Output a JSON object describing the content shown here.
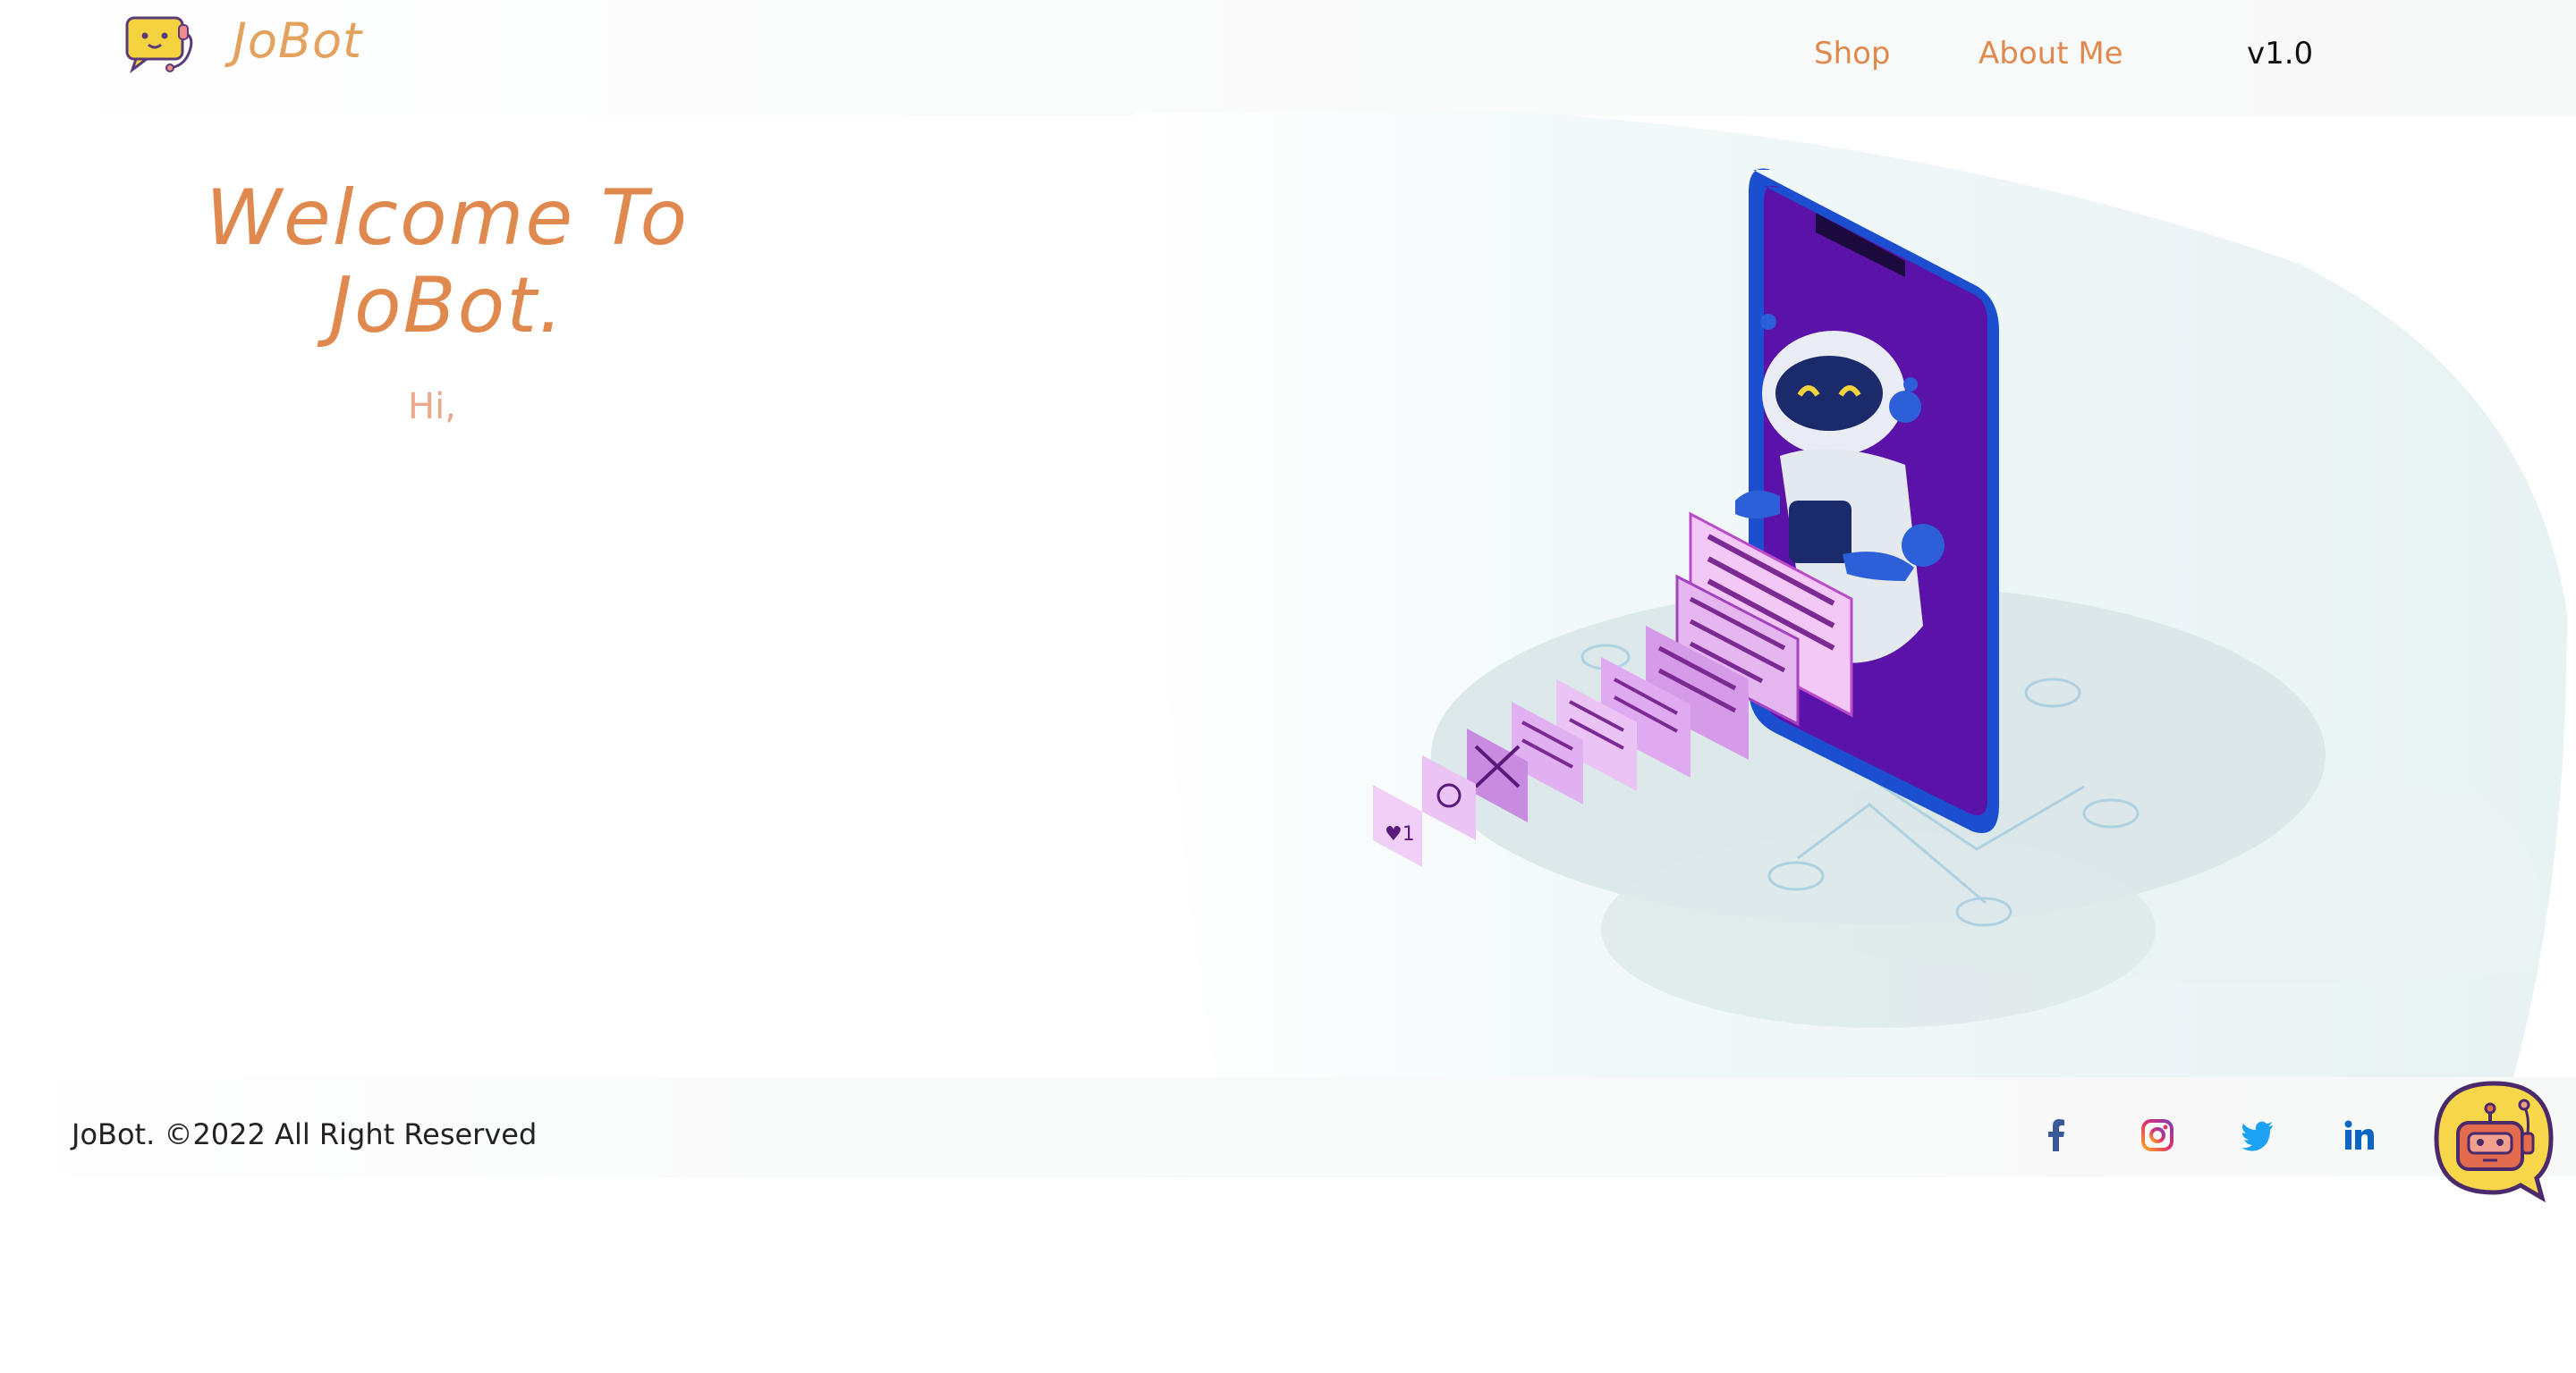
{
  "header": {
    "brand": "JoBot",
    "nav": [
      {
        "label": "Shop"
      },
      {
        "label": "About Me"
      }
    ],
    "version": "v1.0"
  },
  "hero": {
    "title_line1": "Welcome To",
    "title_line2": "JoBot.",
    "greeting": "Hi,",
    "illustration_icon": "robot-phone-chat-illustration"
  },
  "footer": {
    "copyright": "JoBot. ©2022 All Right Reserved",
    "social": [
      {
        "icon": "facebook-icon"
      },
      {
        "icon": "instagram-icon"
      },
      {
        "icon": "twitter-icon"
      },
      {
        "icon": "linkedin-icon"
      }
    ],
    "chat_launcher_icon": "robot-chat-icon"
  },
  "colors": {
    "accent": "#e0894f",
    "brand": "#e3a35f",
    "phone_screen": "#5b12a8",
    "phone_frame": "#1c4fd0"
  }
}
